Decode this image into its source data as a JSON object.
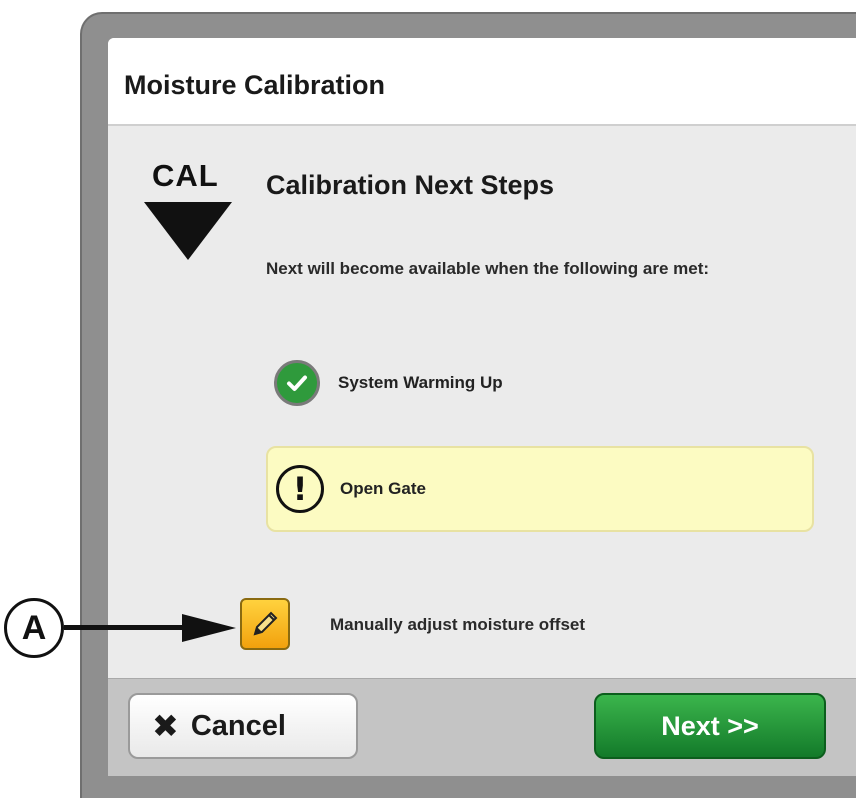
{
  "dialog": {
    "title": "Moisture Calibration",
    "cal_label": "CAL",
    "steps_title": "Calibration Next Steps",
    "steps_description": "Next will become available when the following are met:",
    "requirements": [
      {
        "label": "System Warming Up",
        "status": "complete",
        "icon": "check-circle-icon"
      },
      {
        "label": "Open Gate",
        "status": "pending",
        "icon": "exclamation-circle-icon"
      }
    ],
    "manual_offset": {
      "label": "Manually adjust moisture offset",
      "icon": "pencil-icon"
    }
  },
  "footer": {
    "cancel_label": "Cancel",
    "cancel_icon": "x-icon",
    "next_label": "Next >>"
  },
  "callout": {
    "label": "A"
  },
  "colors": {
    "next_button": "#1f8c33",
    "pending_highlight": "#fcfbc2",
    "check_green": "#2f9a3c",
    "pencil_button": "#f5b21a"
  }
}
